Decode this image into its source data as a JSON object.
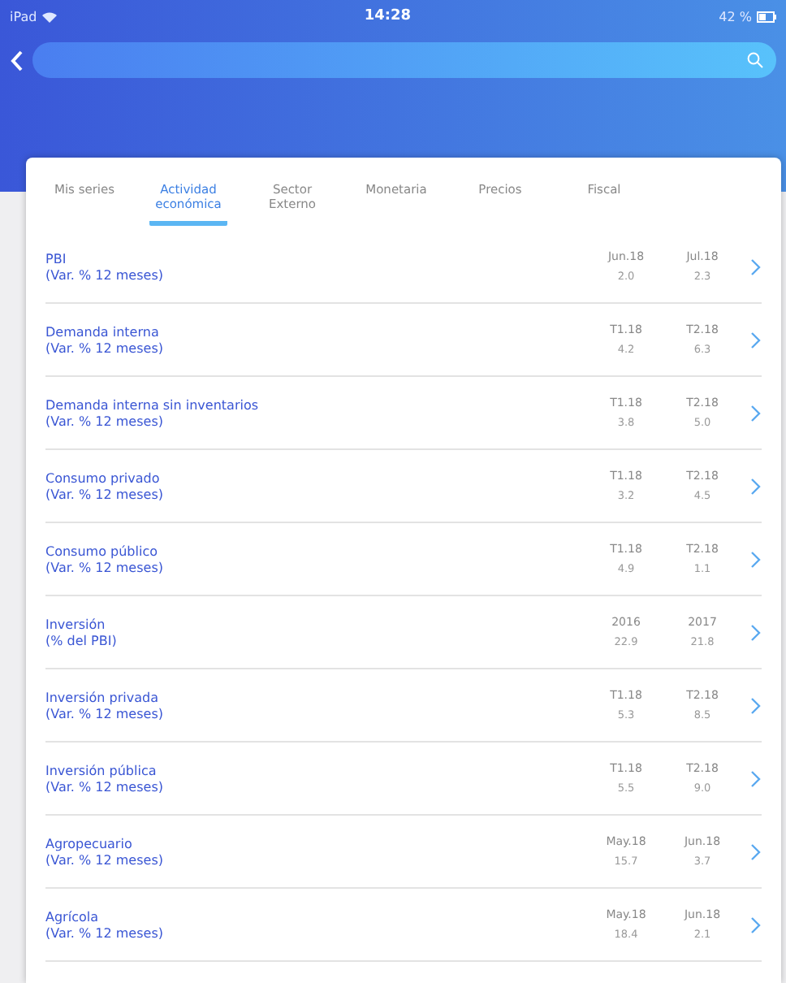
{
  "status_bar": {
    "device": "iPad",
    "time": "14:28",
    "battery": "42 %"
  },
  "tabs": [
    {
      "label": "Mis series",
      "selected": false
    },
    {
      "label": "Actividad económica",
      "selected": true
    },
    {
      "label": "Sector Externo",
      "selected": false
    },
    {
      "label": "Monetaria",
      "selected": false
    },
    {
      "label": "Precios",
      "selected": false
    },
    {
      "label": "Fiscal",
      "selected": false
    }
  ],
  "rows": [
    {
      "name": "PBI",
      "unit": "(Var. % 12 meses)",
      "period_1": "Jun.18",
      "value_1": "2.0",
      "period_2": "Jul.18",
      "value_2": "2.3"
    },
    {
      "name": "Demanda interna",
      "unit": "(Var. % 12 meses)",
      "period_1": "T1.18",
      "value_1": "4.2",
      "period_2": "T2.18",
      "value_2": "6.3"
    },
    {
      "name": "Demanda interna sin inventarios",
      "unit": "(Var. % 12 meses)",
      "period_1": "T1.18",
      "value_1": "3.8",
      "period_2": "T2.18",
      "value_2": "5.0"
    },
    {
      "name": "Consumo privado",
      "unit": "(Var. % 12 meses)",
      "period_1": "T1.18",
      "value_1": "3.2",
      "period_2": "T2.18",
      "value_2": "4.5"
    },
    {
      "name": "Consumo público",
      "unit": "(Var. % 12 meses)",
      "period_1": "T1.18",
      "value_1": "4.9",
      "period_2": "T2.18",
      "value_2": "1.1"
    },
    {
      "name": "Inversión",
      "unit": "(% del PBI)",
      "period_1": "2016",
      "value_1": "22.9",
      "period_2": "2017",
      "value_2": "21.8"
    },
    {
      "name": "Inversión privada",
      "unit": "(Var. % 12 meses)",
      "period_1": "T1.18",
      "value_1": "5.3",
      "period_2": "T2.18",
      "value_2": "8.5"
    },
    {
      "name": "Inversión pública",
      "unit": "(Var. % 12 meses)",
      "period_1": "T1.18",
      "value_1": "5.5",
      "period_2": "T2.18",
      "value_2": "9.0"
    },
    {
      "name": "Agropecuario",
      "unit": "(Var. % 12 meses)",
      "period_1": "May.18",
      "value_1": "15.7",
      "period_2": "Jun.18",
      "value_2": "3.7"
    },
    {
      "name": "Agrícola",
      "unit": "(Var. % 12 meses)",
      "period_1": "May.18",
      "value_1": "18.4",
      "period_2": "Jun.18",
      "value_2": "2.1"
    }
  ]
}
